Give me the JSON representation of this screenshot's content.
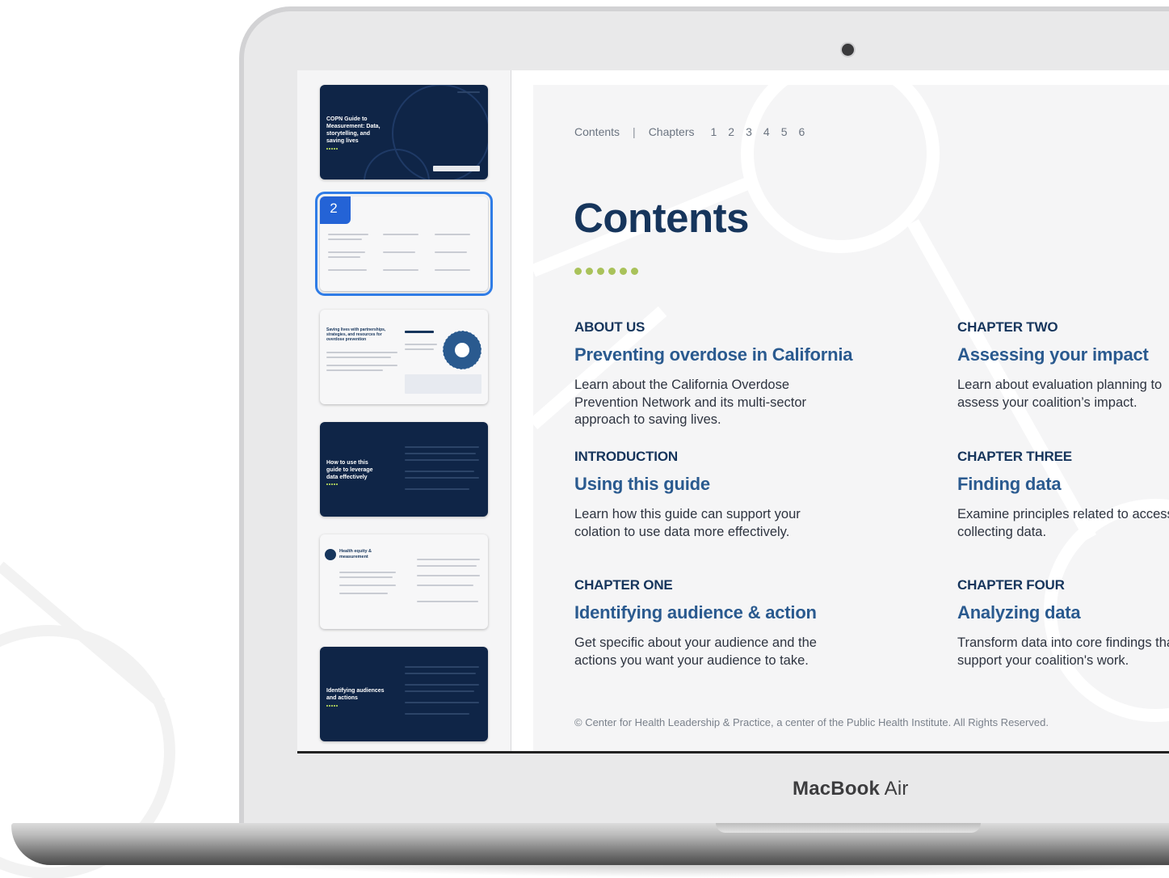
{
  "laptop": {
    "brand_bold": "MacBook",
    "brand_light": "Air"
  },
  "sidebar": {
    "thumbnails": [
      {
        "title": "COPN Guide to Measurement: Data, storytelling, and saving lives",
        "theme": "dark"
      },
      {
        "page_number": "2",
        "theme": "light",
        "selected": true
      },
      {
        "title": "Saving lives with partnerships, strategies, and resources for overdose prevention",
        "theme": "light"
      },
      {
        "title": "How to use this guide to leverage data effectively",
        "theme": "dark"
      },
      {
        "title": "Health equity & measurement",
        "theme": "light"
      },
      {
        "title": "Identifying audiences and actions",
        "theme": "dark"
      }
    ]
  },
  "doc": {
    "nav": {
      "contents": "Contents",
      "chapters": "Chapters",
      "pages": [
        "1",
        "2",
        "3",
        "4",
        "5",
        "6"
      ]
    },
    "title": "Contents",
    "sections": [
      {
        "category": "ABOUT US",
        "heading": "Preventing overdose in California",
        "description": "Learn about the California Overdose Prevention Network and its multi-sector approach to saving lives."
      },
      {
        "category": "INTRODUCTION",
        "heading": "Using this guide",
        "description": "Learn how this guide can support your colation to use data more effectively."
      },
      {
        "category": "CHAPTER ONE",
        "heading": "Identifying audience & action",
        "description": "Get specific about your audience and the actions you want your audience to take."
      },
      {
        "category": "CHAPTER TWO",
        "heading": "Assessing your impact",
        "description": "Learn about evaluation planning to assess your coalition’s impact."
      },
      {
        "category": "CHAPTER THREE",
        "heading": "Finding data",
        "description": "Examine principles related to accessing and collecting data."
      },
      {
        "category": "CHAPTER FOUR",
        "heading": "Analyzing data",
        "description": "Transform data into core findings that support your coalition's work."
      }
    ],
    "footer": "© Center for Health Leadership & Practice, a center of the Public Health Institute. All Rights Reserved."
  },
  "colors": {
    "navy": "#16355c",
    "heading_blue": "#2a5a8f",
    "accent_green": "#a9c25a",
    "selection_blue": "#2463d6"
  }
}
